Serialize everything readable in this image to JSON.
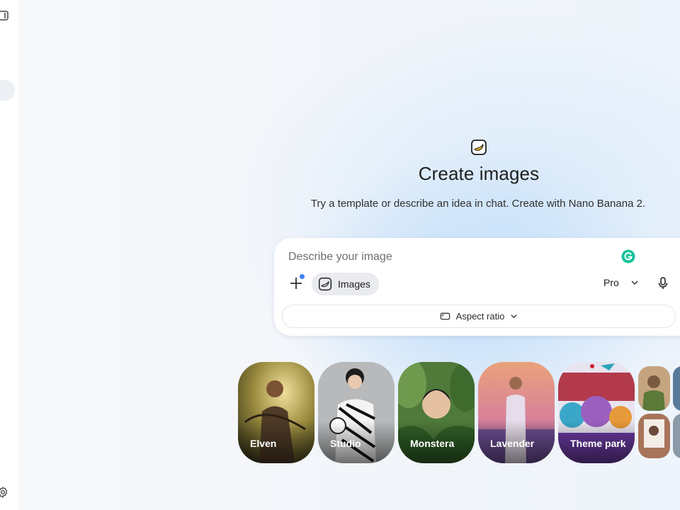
{
  "hero": {
    "title": "Create images",
    "subtitle": "Try a template or describe an idea in chat. Create with Nano Banana 2."
  },
  "composer": {
    "placeholder": "Describe your image",
    "tool_chip_label": "Images",
    "model_label": "Pro",
    "aspect_ratio_label": "Aspect ratio"
  },
  "templates": [
    {
      "label": "Elven"
    },
    {
      "label": "Studio"
    },
    {
      "label": "Monstera"
    },
    {
      "label": "Lavender"
    },
    {
      "label": "Theme park"
    }
  ],
  "icons": {
    "sidebar_toggle": "sidebar-toggle-icon",
    "settings": "gear-icon",
    "hero": "banana-icon",
    "grammarly": "grammarly-icon",
    "add": "plus-icon",
    "images_tool": "banana-icon",
    "model_menu": "chevron-down-icon",
    "mic": "mic-icon",
    "aspect": "aspect-ratio-icon"
  },
  "colors": {
    "accent_blue": "#3b82f6",
    "grammarly_green": "#15c39a",
    "banana_yellow": "#f7c61b"
  }
}
